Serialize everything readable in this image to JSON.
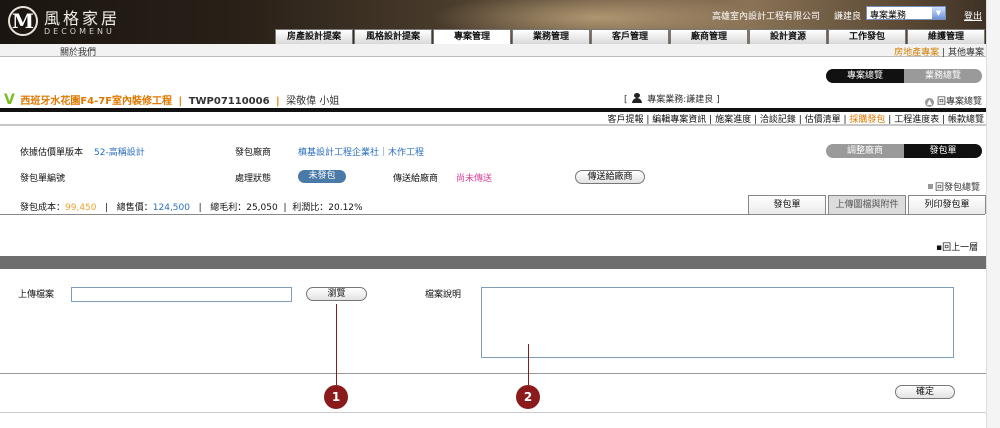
{
  "header": {
    "logo_cn": "風格家居",
    "logo_en": "DECOMENU",
    "logo_mark": "M",
    "company": "高雄室內設計工程有限公司",
    "user": "謙建良",
    "role_selected": "專案業務",
    "logout": "登出",
    "nav_tabs": [
      "房產設計提案",
      "風格設計提案",
      "專案管理",
      "業務管理",
      "客戶管理",
      "廠商管理",
      "設計資源",
      "工作發包",
      "維護管理"
    ]
  },
  "subbar": {
    "about": "關於我們",
    "link_active": "房地產專案",
    "sep": "|",
    "link_other": "其他專案"
  },
  "view_toggle": {
    "left": "專案總覽",
    "right": "業務總覽"
  },
  "project": {
    "marker": "V",
    "name": "西班牙水花園F4-7F室內裝修工程",
    "sep": "|",
    "code": "TWP07110006",
    "client": "梁敬偉 小姐",
    "pm_prefix": "[",
    "pm_label": "專案業務:謙建良",
    "pm_suffix": "]",
    "back_label": "回專案總覽"
  },
  "func_links": [
    "客戶提報",
    "編輯專案資訊",
    "施案進度",
    "洽談記錄",
    "估價清單",
    "採購發包",
    "工程進度表",
    "帳款總覽"
  ],
  "func_active": "採購發包",
  "toggle2": {
    "left": "調整廠商",
    "right": "發包單"
  },
  "info": {
    "estimate_label": "依據估價單版本",
    "estimate_value": "52-高稱設計",
    "vendor_label": "發包廠商",
    "vendor_value": "槙基設計工程企業社｜木作工程",
    "order_no_label": "發包單編號",
    "status_label": "處理狀態",
    "status_value": "未發包",
    "send_label": "傳送給廠商",
    "send_value": "尚未傳送",
    "send_button": "傳送給廠商",
    "back_list": "回發包總覽",
    "cost_label": "發包成本：",
    "cost_value": "99,450",
    "total_label": "總售價：",
    "total_value": "124,500",
    "profit_label": "總毛利：",
    "profit_value": "25,050",
    "ratio_label": "利潤比：",
    "ratio_value": "20.12%",
    "bar": "|"
  },
  "subtabs": [
    "發包單",
    "上傳圖檔與附件",
    "列印發包單"
  ],
  "subtab_active": 1,
  "back_top": "回上一層",
  "form": {
    "upload_label": "上傳檔案",
    "upload_value": "",
    "browse_button": "瀏覽",
    "desc_label": "檔案說明",
    "desc_value": "",
    "confirm_button": "確定"
  },
  "callouts": [
    "1",
    "2"
  ],
  "colors": {
    "accent_orange": "#e07800",
    "brand_green": "#7bbf1f",
    "callout_red": "#8b1a1a",
    "pill_blue": "#4a7aa8"
  }
}
